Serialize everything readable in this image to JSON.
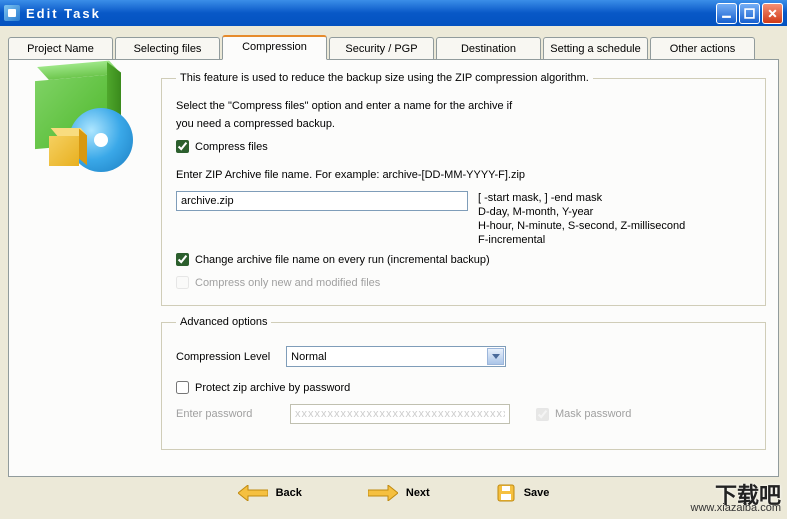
{
  "title": "Edit Task",
  "tabs": [
    "Project Name",
    "Selecting files",
    "Compression",
    "Security / PGP",
    "Destination",
    "Setting a schedule",
    "Other actions"
  ],
  "active_tab": 2,
  "group1": {
    "legend": "This feature is used to reduce the backup size using the ZIP compression algorithm.",
    "intro1": "Select the \"Compress files\" option and enter a name for the archive if",
    "intro2": "you need a compressed backup.",
    "compress_files": {
      "label": "Compress files",
      "checked": true
    },
    "filename_label": "Enter ZIP Archive file name.  For example:   archive-[DD-MM-YYYY-F].zip",
    "filename_value": "archive.zip",
    "mask1": "[ -start mask,  ] -end mask",
    "mask2": "D-day, M-month, Y-year",
    "mask3": "H-hour, N-minute, S-second,  Z-millisecond",
    "mask4": "F-incremental",
    "change_name": {
      "label": "Change archive file name on every run (incremental backup)",
      "checked": true
    },
    "compress_new": {
      "label": "Compress only new and modified files",
      "checked": false,
      "enabled": false
    }
  },
  "group2": {
    "legend": "Advanced options",
    "level_label": "Compression Level",
    "level_value": "Normal",
    "protect": {
      "label": "Protect zip archive by password",
      "checked": false
    },
    "pw_label": "Enter password",
    "pw_value": "xxxxxxxxxxxxxxxxxxxxxxxxxxxxxxxxxx",
    "mask_pw": {
      "label": "Mask password",
      "checked": true
    }
  },
  "footer": {
    "back": "Back",
    "next": "Next",
    "save": "Save"
  },
  "watermark": {
    "big": "下载吧",
    "url": "www.xiazaiba.com"
  }
}
